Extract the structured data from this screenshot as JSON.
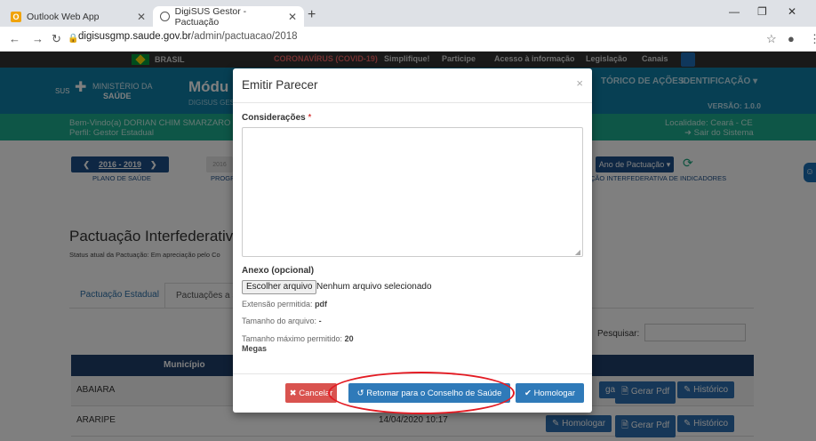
{
  "browser": {
    "tabs": [
      {
        "title": "Outlook Web App",
        "icon": "outlook-icon"
      },
      {
        "title": "DigiSUS Gestor - Pactuação",
        "icon": "globe-icon"
      }
    ],
    "url_host": "digisusgmp.saude.gov.br",
    "url_path": "/admin/pactuacao/2018"
  },
  "govbar": {
    "brasil": "BRASIL",
    "items": [
      "CORONAVÍRUS (COVID-19)",
      "Simplifique!",
      "Participe",
      "Acesso à informação",
      "Legislação",
      "Canais"
    ]
  },
  "header": {
    "sus": "SUS",
    "ministerio": "MINISTÉRIO DA",
    "saude": "SAÚDE",
    "modulo": "Módu",
    "sub": "DIGISUS GES",
    "historico": "TÓRICO DE AÇÕES",
    "identificacao": "IDENTIFICAÇÃO ▾",
    "versao": "VERSÃO: 1.0.0"
  },
  "welcome": {
    "user": "Bem-Vindo(a) DORIAN CHIM SMARZARO",
    "perfil": "Perfil: Gestor Estadual",
    "localidade": "Localidade: Ceará - CE",
    "sair": "Sair do Sistema"
  },
  "navrow": {
    "plano_period": "2016 - 2019",
    "plano_label": "PLANO DE SAÚDE",
    "prog_year": "2016",
    "prog_label": "PROGR",
    "ano_btn": "Ano de Pactuação",
    "pact_label": "ÇÃO INTERFEDERATIVA DE INDICADORES"
  },
  "page": {
    "title": "Pactuação Interfederativa",
    "status": "Status atual da Pactuação: Em apreciação pelo Co",
    "tabs": [
      "Pactuação Estadual",
      "Pactuações a s"
    ],
    "search_label": "Pesquisar:",
    "table_header": "Município",
    "rows": [
      {
        "municipio": "ABAIARA",
        "date": "",
        "b1": "gar",
        "b2": "Gerar Pdf",
        "b3": "Histórico"
      },
      {
        "municipio": "ARARIPE",
        "date": "14/04/2020 10:17",
        "b1": "Homologar",
        "b2": "Gerar Pdf",
        "b3": "Histórico"
      }
    ]
  },
  "modal": {
    "title": "Emitir Parecer",
    "close": "×",
    "consid_label": "Considerações",
    "required": "*",
    "anexo_label": "Anexo (opcional)",
    "file_button": "Escolher arquivo",
    "file_status": "Nenhum arquivo selecionado",
    "ext_label": "Extensão permitida:",
    "ext_value": "pdf",
    "size_label": "Tamanho do arquivo:",
    "size_value": "-",
    "max_label": "Tamanho máximo permitido:",
    "max_value": "20",
    "max_unit": "Megas",
    "cancel": "Cancelar",
    "retomar": "Retomar para o Conselho de Saúde",
    "homologar": "Homologar"
  }
}
